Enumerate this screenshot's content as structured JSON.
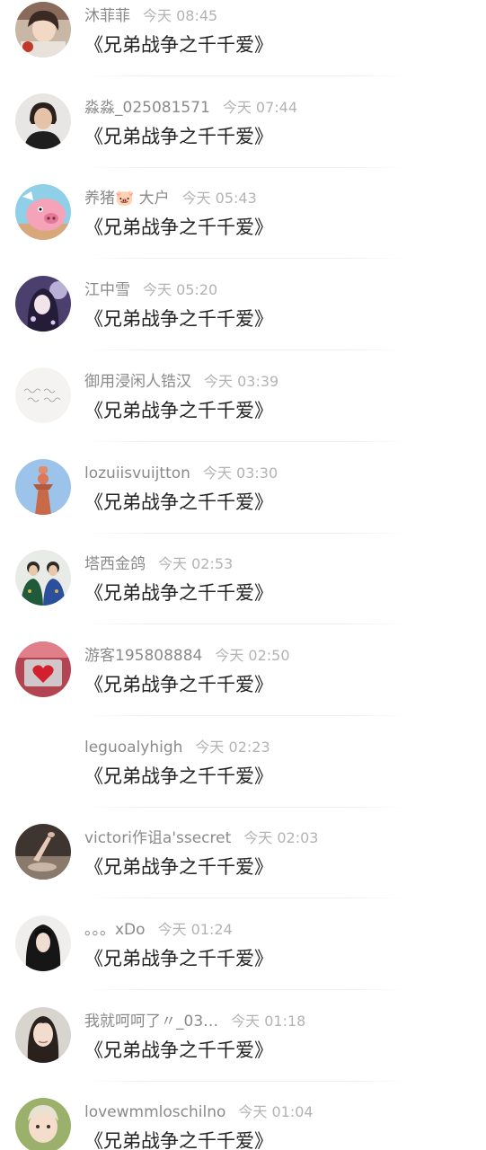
{
  "chat_list": {
    "items": [
      {
        "name": "沐菲菲",
        "time": "今天 08:45",
        "message": "《兄弟战争之千千爱》",
        "avatar": "portrait-girl-avatar"
      },
      {
        "name": "淼淼_025081571",
        "time": "今天 07:44",
        "message": "《兄弟战争之千千爱》",
        "avatar": "portrait-woman-avatar"
      },
      {
        "name": "养猪🐷 大户",
        "time": "今天 05:43",
        "message": "《兄弟战争之千千爱》",
        "avatar": "cartoon-pig-avatar"
      },
      {
        "name": "江中雪",
        "time": "今天 05:20",
        "message": "《兄弟战争之千千爱》",
        "avatar": "anime-girl-avatar"
      },
      {
        "name": "御用浸闲人锆汉",
        "time": "今天 03:39",
        "message": "《兄弟战争之千千爱》",
        "avatar": "handwriting-avatar"
      },
      {
        "name": "lozuiisvuijtton",
        "time": "今天 03:30",
        "message": "《兄弟战争之千千爱》",
        "avatar": "statue-sky-avatar"
      },
      {
        "name": "塔西金鸽",
        "time": "今天 02:53",
        "message": "《兄弟战争之千千爱》",
        "avatar": "couple-avatar"
      },
      {
        "name": "游客195808884",
        "time": "今天 02:50",
        "message": "《兄弟战争之千千爱》",
        "avatar": "red-heart-avatar"
      },
      {
        "name": "leguoalyhigh",
        "time": "今天 02:23",
        "message": "《兄弟战争之千千爱》",
        "avatar": "blank-avatar"
      },
      {
        "name": "victori作诅a'ssecret",
        "time": "今天 02:03",
        "message": "《兄弟战争之千千爱》",
        "avatar": "dark-photo-avatar"
      },
      {
        "name": "。。。xDo",
        "time": "今天 01:24",
        "message": "《兄弟战争之千千爱》",
        "avatar": "dark-hair-girl-avatar"
      },
      {
        "name": "我就呵呵了〃_03…",
        "time": "今天 01:18",
        "message": "《兄弟战争之千千爱》",
        "avatar": "selfie-girl-avatar"
      },
      {
        "name": "lovewmmloschilno",
        "time": "今天 01:04",
        "message": "《兄弟战争之千千爱》",
        "avatar": "child-avatar"
      }
    ]
  }
}
